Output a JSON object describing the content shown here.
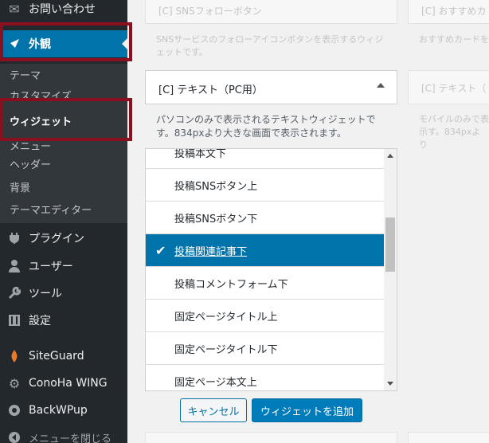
{
  "sidebar": {
    "menu": [
      {
        "label": "お問い合わせ",
        "icon": "envelope-icon"
      },
      {
        "label": "外観",
        "icon": "paintbrush-icon"
      },
      {
        "label": "プラグイン",
        "icon": "plugin-icon"
      },
      {
        "label": "ユーザー",
        "icon": "user-icon"
      },
      {
        "label": "ツール",
        "icon": "wrench-icon"
      },
      {
        "label": "設定",
        "icon": "settings-icon"
      },
      {
        "label": "SiteGuard",
        "icon": "siteguard-icon"
      },
      {
        "label": "ConoHa WING",
        "icon": "gear-icon"
      },
      {
        "label": "BackWPup",
        "icon": "backwpup-icon"
      },
      {
        "label": "メニューを閉じる",
        "icon": "collapse-icon"
      }
    ],
    "submenu": [
      {
        "label": "テーマ"
      },
      {
        "label": "カスタマイズ"
      },
      {
        "label": "ウィジェット"
      },
      {
        "label": "メニュー"
      },
      {
        "label": "ヘッダー"
      },
      {
        "label": "背景"
      },
      {
        "label": "テーマエディター"
      }
    ]
  },
  "faded_widgets": {
    "sns_title": "[C] SNSフォローボタン",
    "sns_desc": "SNSサービスのフォローアイコンボタンを表示するウィジェットです。",
    "recommend_title": "[C] おすすめカ",
    "recommend_desc": "おすすめカードを",
    "text_mobile_title": "[C] テキスト（",
    "text_mobile_desc": "モバイルのみで表示す。834pxより"
  },
  "widget": {
    "title": "[C] テキスト（PC用）",
    "description": "パソコンのみで表示されるテキストウィジェットです。834pxより大きな画面で表示されます。"
  },
  "list": {
    "items": [
      {
        "label": "投稿本文下"
      },
      {
        "label": "投稿SNSボタン上"
      },
      {
        "label": "投稿SNSボタン下"
      },
      {
        "label": "投稿関連記事下",
        "selected": true
      },
      {
        "label": "投稿コメントフォーム下"
      },
      {
        "label": "固定ページタイトル上"
      },
      {
        "label": "固定ページタイトル下"
      },
      {
        "label": "固定ページ本文上"
      }
    ]
  },
  "buttons": {
    "cancel": "キャンセル",
    "add": "ウィジェットを追加"
  },
  "colors": {
    "accent": "#0073aa",
    "highlight_border": "#8b0f1e",
    "sidebar_bg": "#23282d"
  }
}
